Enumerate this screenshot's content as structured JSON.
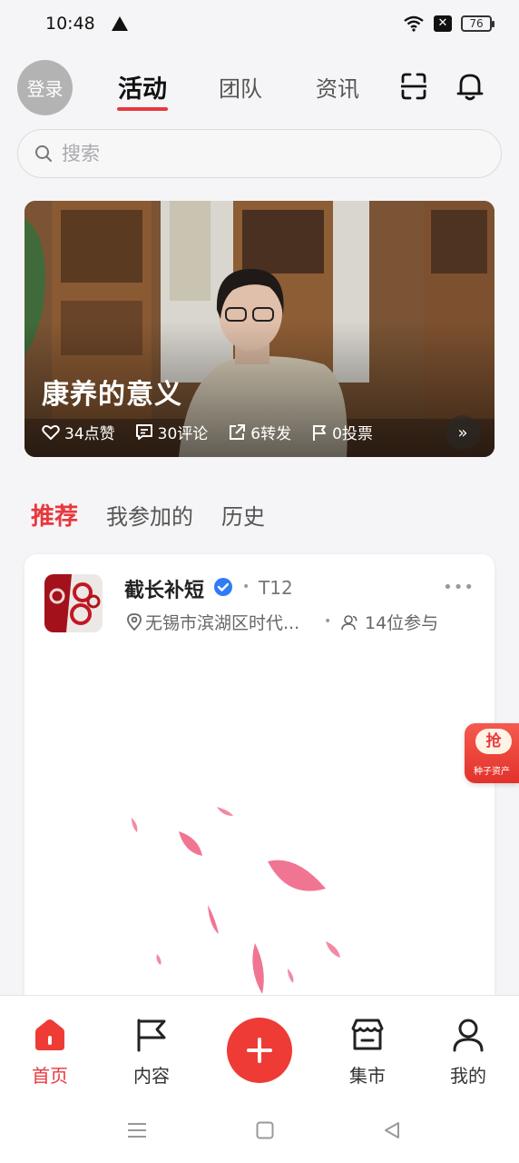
{
  "status_bar": {
    "time": "10:48",
    "battery": "76"
  },
  "header": {
    "login_label": "登录",
    "tabs": [
      {
        "label": "活动",
        "active": true
      },
      {
        "label": "团队",
        "active": false
      },
      {
        "label": "资讯",
        "active": false
      }
    ]
  },
  "search": {
    "placeholder": "搜索"
  },
  "banner": {
    "title": "康养的意义",
    "likes": "34点赞",
    "comments": "30评论",
    "shares": "6转发",
    "votes": "0投票"
  },
  "sub_tabs": [
    {
      "label": "推荐",
      "active": true
    },
    {
      "label": "我参加的",
      "active": false
    },
    {
      "label": "历史",
      "active": false
    }
  ],
  "card": {
    "title": "截长补短",
    "tag": "T12",
    "location": "无锡市滨湖区时代...",
    "participants": "14位参与"
  },
  "float_badge": {
    "top": "抢",
    "bottom": "种子资产"
  },
  "bottom_nav": [
    {
      "label": "首页",
      "icon": "home-icon",
      "active": true
    },
    {
      "label": "内容",
      "icon": "flag-icon",
      "active": false
    },
    {
      "label": "集市",
      "icon": "store-icon",
      "active": false
    },
    {
      "label": "我的",
      "icon": "user-icon",
      "active": false
    }
  ],
  "colors": {
    "accent": "#e8383d",
    "background": "#f5f5f7"
  }
}
